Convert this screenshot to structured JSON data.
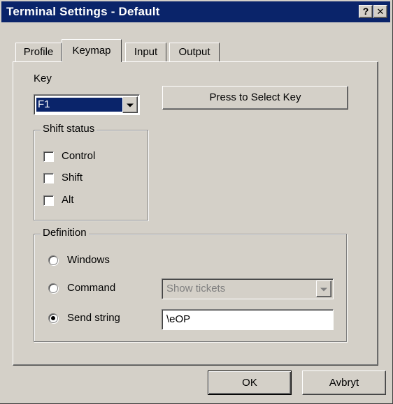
{
  "window": {
    "title": "Terminal Settings - Default",
    "help_button": "?",
    "close_button": "✕"
  },
  "tabs": [
    {
      "label": "Profile",
      "active": false
    },
    {
      "label": "Keymap",
      "active": true
    },
    {
      "label": "Input",
      "active": false
    },
    {
      "label": "Output",
      "active": false
    }
  ],
  "key_section": {
    "label": "Key",
    "selected_key": "F1",
    "select_key_button": "Press to Select Key"
  },
  "shift_status": {
    "label": "Shift status",
    "options": [
      {
        "label": "Control",
        "checked": false
      },
      {
        "label": "Shift",
        "checked": false
      },
      {
        "label": "Alt",
        "checked": false
      }
    ]
  },
  "definition": {
    "label": "Definition",
    "options": [
      {
        "label": "Windows",
        "selected": false
      },
      {
        "label": "Command",
        "selected": false
      },
      {
        "label": "Send string",
        "selected": true
      }
    ],
    "command_value": "Show tickets",
    "send_string_value": "\\eOP"
  },
  "buttons": {
    "ok": "OK",
    "cancel": "Avbryt"
  },
  "colors": {
    "titlebar": "#0a246a",
    "face": "#d4d0c8",
    "selection": "#0a246a"
  }
}
